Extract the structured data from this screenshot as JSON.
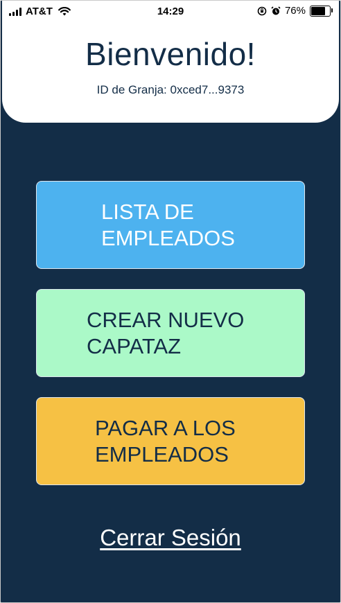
{
  "status_bar": {
    "carrier": "AT&T",
    "time": "14:29",
    "battery": "76%",
    "battery_level": 0.76
  },
  "header": {
    "title": "Bienvenido!",
    "farm_id": "ID de Granja: 0xced7...9373"
  },
  "actions": {
    "employee_list": "LISTA DE\nEMPLEADOS",
    "create_foreman": "CREAR NUEVO\nCAPATAZ",
    "pay_employees": "PAGAR A LOS\nEMPLEADOS"
  },
  "logout": "Cerrar Sesión",
  "colors": {
    "background": "#132d47",
    "employees_button": "#4db2ef",
    "foreman_button": "#abf9c8",
    "pay_button": "#f6c144"
  }
}
